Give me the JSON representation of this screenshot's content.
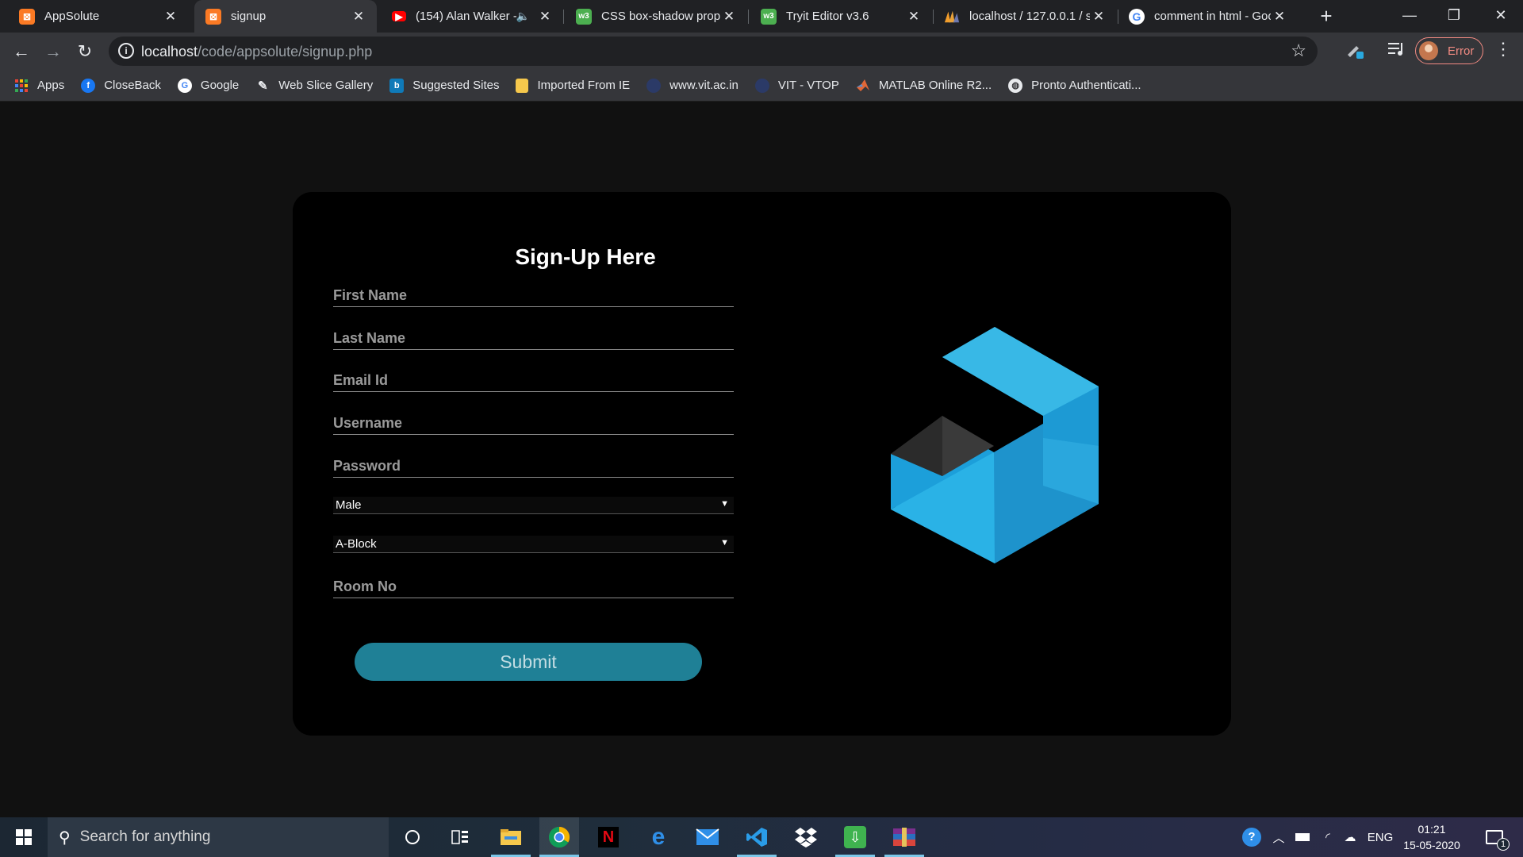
{
  "browser": {
    "tabs": [
      {
        "title": "AppSolute",
        "icon": "xampp-icon",
        "active": false
      },
      {
        "title": "signup",
        "icon": "xampp-icon",
        "active": true
      },
      {
        "title": "(154) Alan Walker -",
        "icon": "youtube-icon",
        "active": false,
        "audio": true
      },
      {
        "title": "CSS box-shadow prope",
        "icon": "w3schools-icon",
        "active": false
      },
      {
        "title": "Tryit Editor v3.6",
        "icon": "w3schools-icon",
        "active": false
      },
      {
        "title": "localhost / 127.0.0.1 / s",
        "icon": "phpmyadmin-icon",
        "active": false
      },
      {
        "title": "comment in html - Goo",
        "icon": "google-icon",
        "active": false
      }
    ],
    "url_host": "localhost",
    "url_path": "/code/appsolute/signup.php",
    "profile_status": "Error",
    "bookmarks": [
      {
        "label": "Apps",
        "icon": "apps-grid-icon"
      },
      {
        "label": "CloseBack",
        "icon": "facebook-icon"
      },
      {
        "label": "Google",
        "icon": "google-icon"
      },
      {
        "label": "Web Slice Gallery",
        "icon": "web-slice-icon"
      },
      {
        "label": "Suggested Sites",
        "icon": "bing-icon"
      },
      {
        "label": "Imported From IE",
        "icon": "folder-icon"
      },
      {
        "label": "www.vit.ac.in",
        "icon": "vit-icon"
      },
      {
        "label": "VIT - VTOP",
        "icon": "vit-icon"
      },
      {
        "label": "MATLAB Online R2...",
        "icon": "matlab-icon"
      },
      {
        "label": "Pronto Authenticati...",
        "icon": "globe-icon"
      }
    ]
  },
  "form": {
    "title": "Sign-Up Here",
    "first_name_placeholder": "First Name",
    "last_name_placeholder": "Last Name",
    "email_placeholder": "Email Id",
    "username_placeholder": "Username",
    "password_placeholder": "Password",
    "gender_selected": "Male",
    "block_selected": "A-Block",
    "room_placeholder": "Room No",
    "submit_label": "Submit"
  },
  "taskbar": {
    "search_text": "Search for anything",
    "language": "ENG",
    "time": "01:21",
    "date": "15-05-2020",
    "notification_count": "1"
  },
  "colors": {
    "accent": "#1f8096",
    "logo_blue": "#29a9df",
    "card_bg": "#000000",
    "page_bg": "#111111"
  }
}
